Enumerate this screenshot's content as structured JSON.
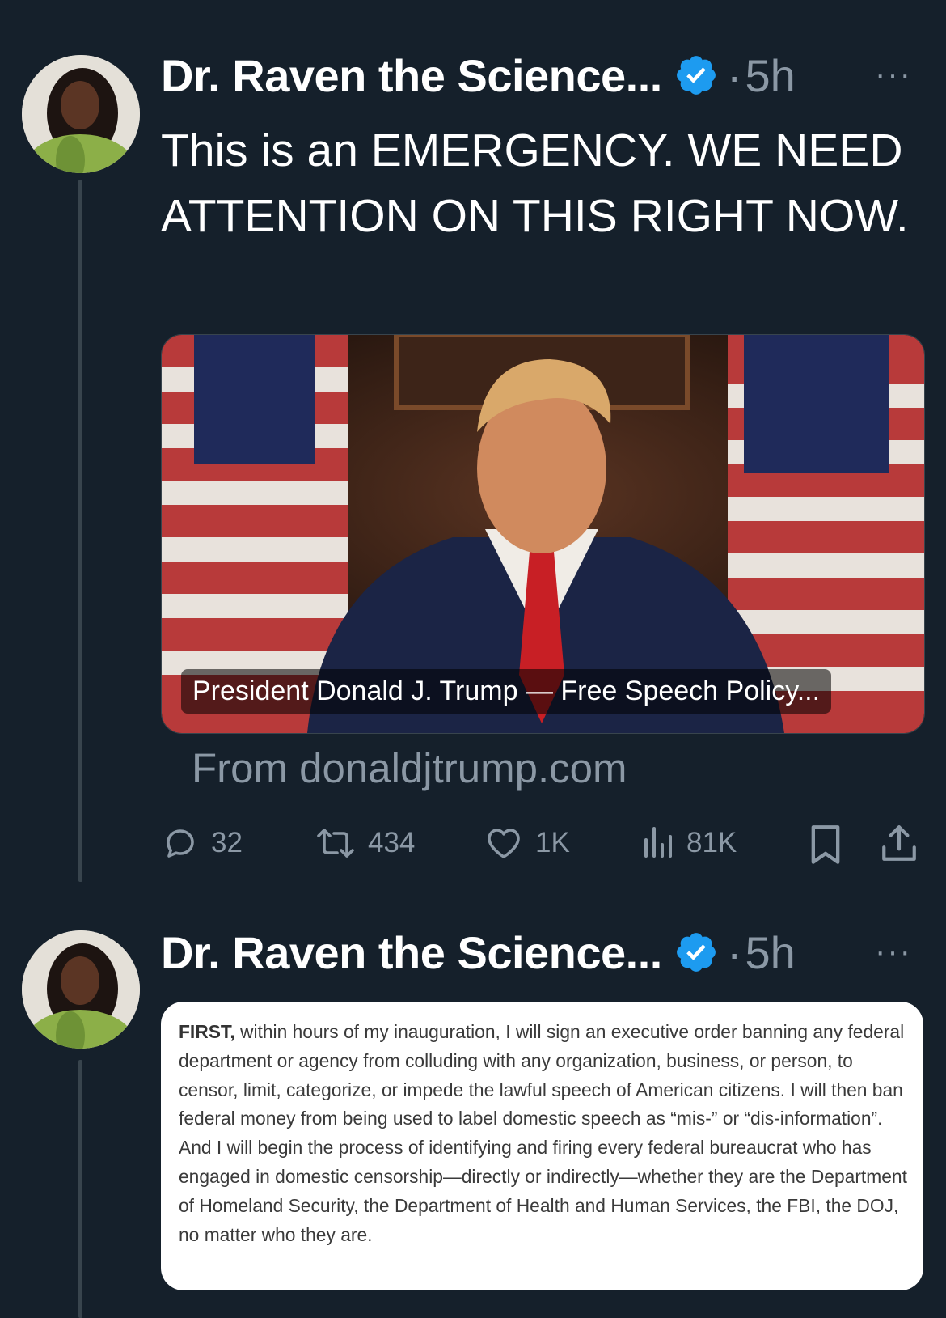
{
  "tweets": [
    {
      "author_name": "Dr. Raven the Science...",
      "time": "5h",
      "text": "This is an EMERGENCY. WE NEED ATTENTION ON THIS RIGHT NOW.",
      "media_caption": "President Donald J. Trump — Free Speech Policy...",
      "source": "From donaldjtrump.com",
      "stats": {
        "replies": "32",
        "retweets": "434",
        "likes": "1K",
        "views": "81K"
      }
    },
    {
      "author_name": "Dr. Raven the Science...",
      "time": "5h",
      "doc_lead": "FIRST,",
      "doc_text": " within hours of my inauguration, I will sign an executive order banning any federal department or agency from colluding with any organization, business, or person, to censor, limit, categorize, or impede the lawful speech of American citizens. I will then ban federal money from being used to label domestic speech as “mis-” or “dis-information”. And I will begin the process of identifying and firing every federal bureaucrat who has engaged in domestic censorship—directly or indirectly—whether they are the Department of Homeland Security, the Department of Health and Human Services, the FBI, the DOJ, no matter who they are."
    }
  ],
  "separator": "·",
  "more_glyph": "···",
  "colors": {
    "background": "#15202b",
    "secondary_text": "#8b98a5",
    "verified_blue": "#1d9bf0",
    "thread_line": "#38444d"
  }
}
